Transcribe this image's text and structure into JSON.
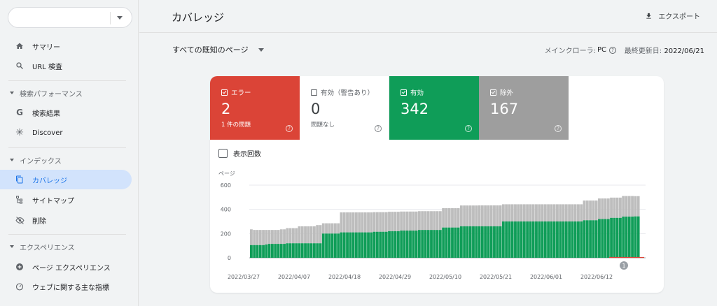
{
  "sidebar": {
    "items": [
      {
        "label": "サマリー",
        "icon": "home-icon"
      },
      {
        "label": "URL 検査",
        "icon": "search-icon"
      },
      {
        "label": "検索結果",
        "icon": "google-icon"
      },
      {
        "label": "Discover",
        "icon": "asterisk-icon"
      },
      {
        "label": "カバレッジ",
        "icon": "copy-icon",
        "active": true
      },
      {
        "label": "サイトマップ",
        "icon": "sitemap-icon"
      },
      {
        "label": "削除",
        "icon": "eye-off-icon"
      },
      {
        "label": "ページ エクスペリエンス",
        "icon": "plus-circle-icon"
      },
      {
        "label": "ウェブに関する主な指標",
        "icon": "speed-icon"
      }
    ],
    "sections": [
      "検索パフォーマンス",
      "インデックス",
      "エクスペリエンス"
    ]
  },
  "header": {
    "title": "カバレッジ",
    "export_label": "エクスポート"
  },
  "subbar": {
    "filter": "すべての既知のページ",
    "crawler_label": "メインクローラ:",
    "crawler_value": "PC",
    "updated_label": "最終更新日:",
    "updated_value": "2022/06/21"
  },
  "tiles": {
    "error": {
      "label": "エラー",
      "value": "2",
      "sub": "1 件の問題"
    },
    "warning": {
      "label": "有効（警告あり）",
      "value": "0",
      "sub": "問題なし"
    },
    "valid": {
      "label": "有効",
      "value": "342"
    },
    "excluded": {
      "label": "除外",
      "value": "167"
    }
  },
  "impressions_label": "表示回数",
  "colors": {
    "error": "#db4437",
    "valid": "#0f9d58",
    "excluded": "#bdbdbd",
    "active": "#1a73e8"
  },
  "chart_data": {
    "type": "bar",
    "ylabel": "ページ",
    "ylim": [
      0,
      600
    ],
    "yticks": [
      0,
      200,
      400,
      600
    ],
    "xticks": [
      "2022/03/27",
      "2022/04/07",
      "2022/04/18",
      "2022/04/29",
      "2022/05/10",
      "2022/05/21",
      "2022/06/01",
      "2022/06/12"
    ],
    "stacked": true,
    "series": [
      {
        "name": "有効",
        "color": "#0f9d58",
        "values": [
          105,
          105,
          105,
          105,
          105,
          110,
          115,
          115,
          115,
          115,
          115,
          115,
          120,
          120,
          120,
          120,
          120,
          120,
          120,
          120,
          120,
          120,
          120,
          120,
          200,
          200,
          200,
          200,
          200,
          200,
          210,
          210,
          210,
          210,
          210,
          210,
          210,
          210,
          210,
          210,
          210,
          215,
          215,
          215,
          215,
          215,
          220,
          220,
          220,
          220,
          225,
          225,
          225,
          225,
          225,
          225,
          230,
          230,
          230,
          230,
          230,
          230,
          230,
          230,
          250,
          250,
          250,
          250,
          250,
          250,
          260,
          260,
          260,
          260,
          260,
          260,
          260,
          260,
          260,
          260,
          260,
          260,
          260,
          260,
          300,
          300,
          300,
          300,
          300,
          300,
          300,
          300,
          300,
          300,
          300,
          300,
          300,
          300,
          300,
          300,
          300,
          300,
          300,
          300,
          300,
          300,
          300,
          300,
          300,
          300,
          300,
          310,
          310,
          310,
          310,
          310,
          320,
          320,
          320,
          320,
          330,
          330,
          330,
          330,
          340,
          340,
          340,
          340,
          342,
          342
        ]
      },
      {
        "name": "除外",
        "color": "#bdbdbd",
        "values": [
          130,
          125,
          125,
          125,
          125,
          120,
          115,
          115,
          115,
          115,
          120,
          120,
          125,
          125,
          125,
          125,
          140,
          140,
          140,
          140,
          140,
          140,
          150,
          150,
          85,
          85,
          85,
          85,
          85,
          85,
          165,
          165,
          165,
          165,
          165,
          165,
          165,
          165,
          165,
          165,
          165,
          162,
          162,
          162,
          162,
          162,
          160,
          160,
          160,
          160,
          157,
          157,
          157,
          157,
          157,
          157,
          155,
          155,
          155,
          155,
          155,
          155,
          155,
          155,
          160,
          160,
          160,
          160,
          160,
          160,
          172,
          172,
          172,
          172,
          172,
          172,
          173,
          173,
          173,
          173,
          173,
          173,
          173,
          173,
          142,
          142,
          142,
          142,
          142,
          142,
          142,
          142,
          142,
          142,
          142,
          142,
          142,
          142,
          142,
          142,
          142,
          142,
          142,
          142,
          142,
          142,
          142,
          142,
          142,
          142,
          142,
          163,
          163,
          163,
          163,
          163,
          170,
          170,
          170,
          170,
          167,
          167,
          167,
          167,
          170,
          170,
          170,
          170,
          167,
          167
        ]
      }
    ],
    "error_marker": "1"
  }
}
